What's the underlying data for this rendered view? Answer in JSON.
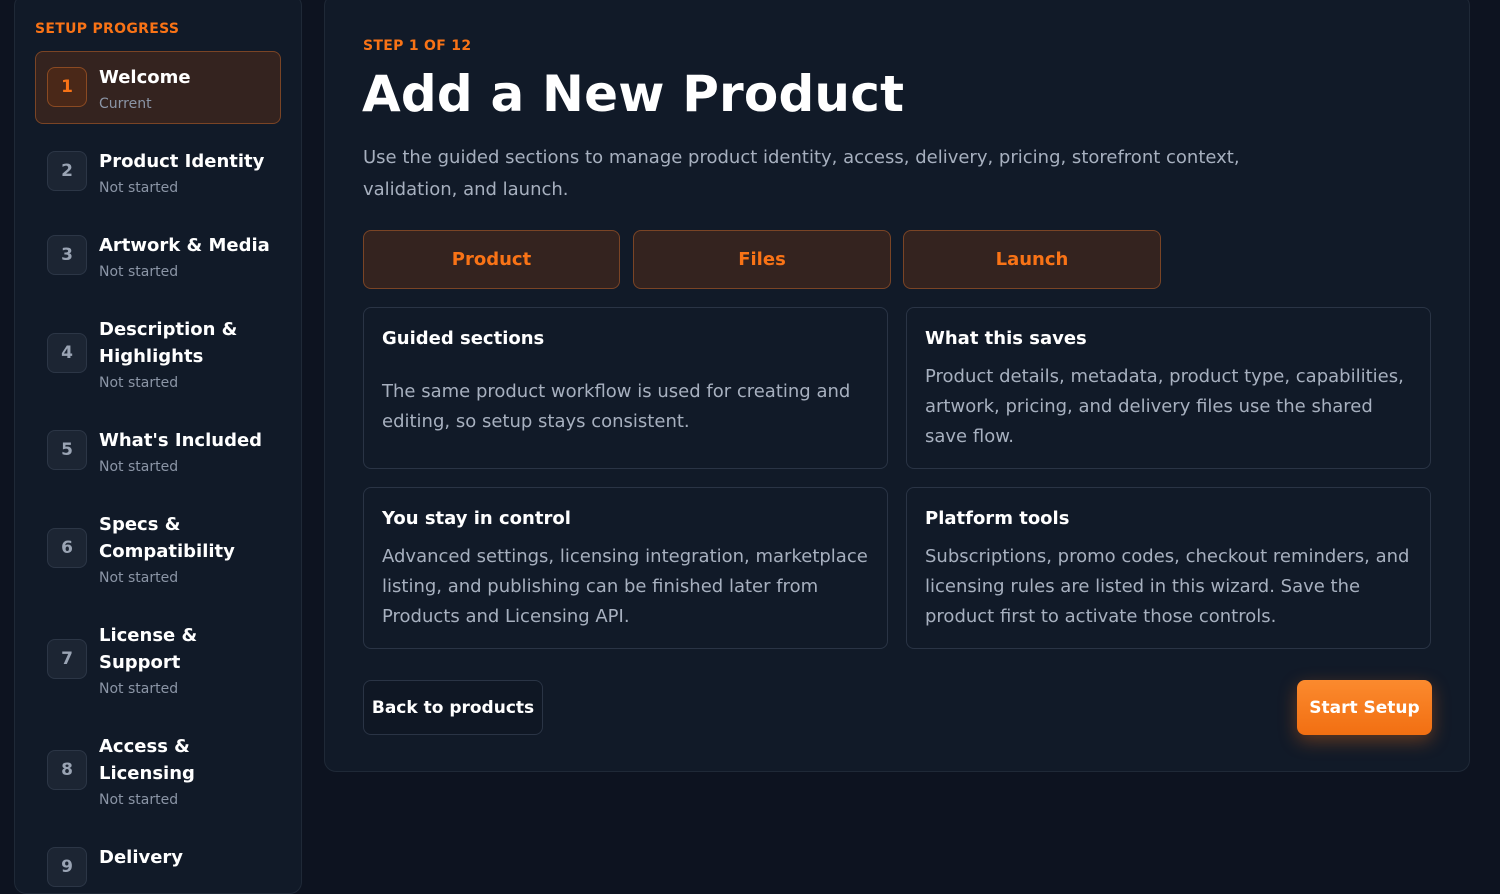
{
  "sidebar": {
    "title": "SETUP PROGRESS",
    "steps": [
      {
        "num": "1",
        "title": "Welcome",
        "status": "Current"
      },
      {
        "num": "2",
        "title": "Product Identity",
        "status": "Not started"
      },
      {
        "num": "3",
        "title": "Artwork & Media",
        "status": "Not started"
      },
      {
        "num": "4",
        "title": "Description & Highlights",
        "status": "Not started"
      },
      {
        "num": "5",
        "title": "What's Included",
        "status": "Not started"
      },
      {
        "num": "6",
        "title": "Specs & Compatibility",
        "status": "Not started"
      },
      {
        "num": "7",
        "title": "License & Support",
        "status": "Not started"
      },
      {
        "num": "8",
        "title": "Access & Licensing",
        "status": "Not started"
      },
      {
        "num": "9",
        "title": "Delivery",
        "status": ""
      }
    ]
  },
  "main": {
    "step_label": "STEP 1 OF 12",
    "title": "Add a New Product",
    "description": "Use the guided sections to manage product identity, access, delivery, pricing, storefront context, validation, and launch.",
    "tabs": [
      "Product",
      "Files",
      "Launch"
    ],
    "cards": [
      {
        "title": "Guided sections",
        "text": "The same product workflow is used for creating and editing, so setup stays consistent."
      },
      {
        "title": "What this saves",
        "text": "Product details, metadata, product type, capabilities, artwork, pricing, and delivery files use the shared save flow."
      },
      {
        "title": "You stay in control",
        "text": "Advanced settings, licensing integration, marketplace listing, and publishing can be finished later from Products and Licensing API."
      },
      {
        "title": "Platform tools",
        "text": "Subscriptions, promo codes, checkout reminders, and licensing rules are listed in this wizard. Save the product first to activate those controls."
      }
    ],
    "back_label": "Back to products",
    "start_label": "Start Setup"
  },
  "colors": {
    "accent": "#f97316",
    "background": "#0d1320",
    "panel": "#111a28"
  }
}
